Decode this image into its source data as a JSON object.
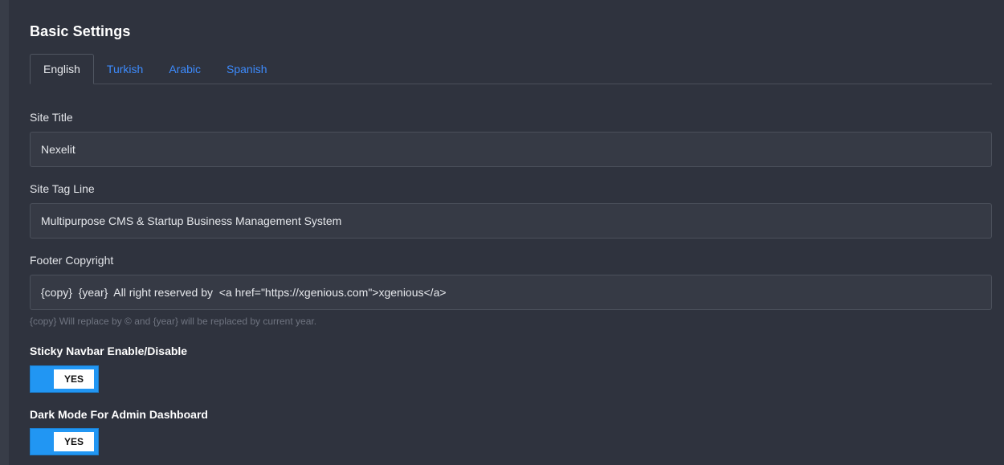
{
  "page": {
    "title": "Basic Settings"
  },
  "tabs": [
    {
      "label": "English",
      "active": true
    },
    {
      "label": "Turkish",
      "active": false
    },
    {
      "label": "Arabic",
      "active": false
    },
    {
      "label": "Spanish",
      "active": false
    }
  ],
  "fields": {
    "site_title": {
      "label": "Site Title",
      "value": "Nexelit"
    },
    "site_tag_line": {
      "label": "Site Tag Line",
      "value": "Multipurpose CMS & Startup Business Management System"
    },
    "footer_copyright": {
      "label": "Footer Copyright",
      "value": "{copy}  {year}  All right reserved by  <a href=\"https://xgenious.com\">xgenious</a>",
      "help": "{copy} Will replace by © and {year} will be replaced by current year."
    }
  },
  "toggles": {
    "sticky_navbar": {
      "label": "Sticky Navbar Enable/Disable",
      "state": "YES",
      "on": true
    },
    "dark_mode": {
      "label": "Dark Mode For Admin Dashboard",
      "state": "YES",
      "on": true
    }
  },
  "colors": {
    "background": "#2f333e",
    "accent": "#3d8bfd",
    "switch_on": "#2196f3"
  }
}
